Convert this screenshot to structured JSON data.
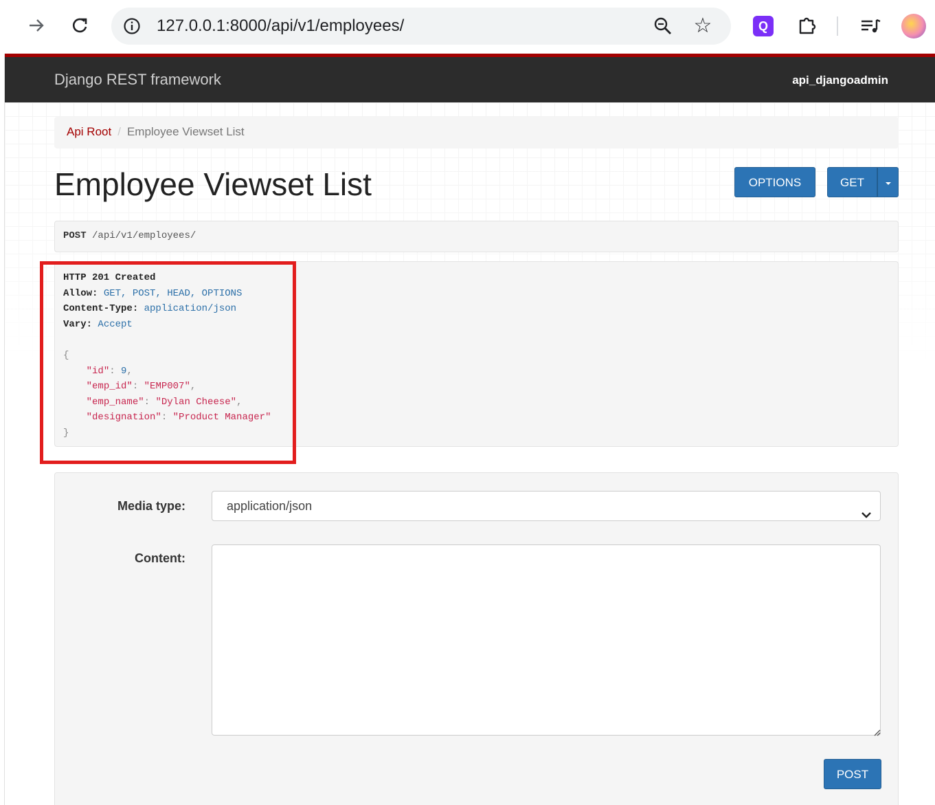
{
  "browser": {
    "url": "127.0.0.1:8000/api/v1/employees/",
    "extension_label": "Q"
  },
  "navbar": {
    "brand": "Django REST framework",
    "user": "api_djangoadmin"
  },
  "breadcrumb": {
    "root": "Api Root",
    "separator": "/",
    "current": "Employee Viewset List"
  },
  "page": {
    "title": "Employee Viewset List"
  },
  "buttons": {
    "options": "OPTIONS",
    "get": "GET",
    "post": "POST"
  },
  "request": {
    "method": "POST",
    "path": "/api/v1/employees/"
  },
  "response": {
    "status": "HTTP 201 Created",
    "headers": [
      {
        "key": "Allow:",
        "value": "GET, POST, HEAD, OPTIONS"
      },
      {
        "key": "Content-Type:",
        "value": "application/json"
      },
      {
        "key": "Vary:",
        "value": "Accept"
      }
    ],
    "body": {
      "open": "{",
      "close": "}",
      "fields": [
        {
          "key": "\"id\"",
          "value": "9",
          "type": "number",
          "trail": ","
        },
        {
          "key": "\"emp_id\"",
          "value": "\"EMP007\"",
          "type": "string",
          "trail": ","
        },
        {
          "key": "\"emp_name\"",
          "value": "\"Dylan Cheese\"",
          "type": "string",
          "trail": ","
        },
        {
          "key": "\"designation\"",
          "value": "\"Product Manager\"",
          "type": "string",
          "trail": ""
        }
      ]
    }
  },
  "form": {
    "media_type_label": "Media type:",
    "media_type_value": "application/json",
    "content_label": "Content:",
    "content_value": ""
  },
  "colors": {
    "accent": "#a30000",
    "button": "#2c74b5",
    "highlight": "#e21d1d"
  }
}
